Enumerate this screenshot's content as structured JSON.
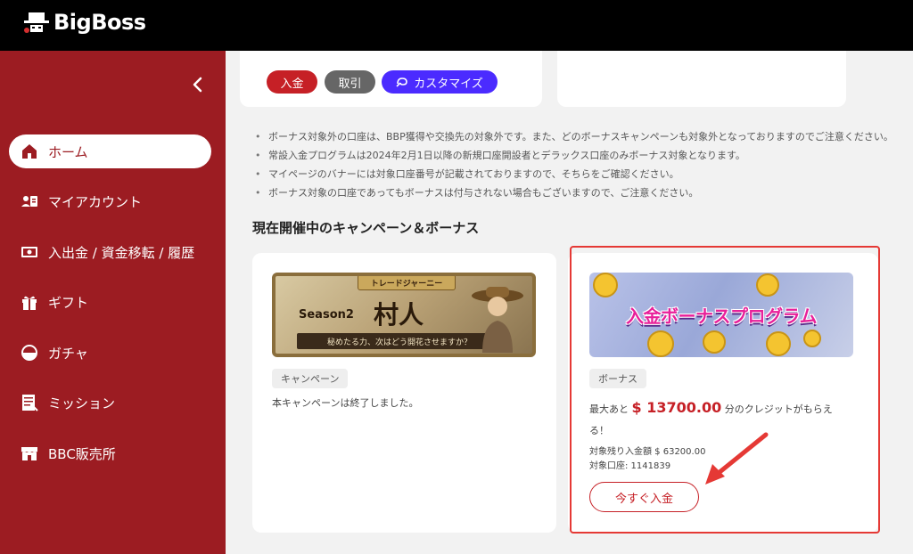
{
  "header": {
    "logo_text": "BigBoss"
  },
  "sidebar": {
    "items": [
      {
        "label": "ホーム",
        "icon": "home-icon",
        "active": true
      },
      {
        "label": "マイアカウント",
        "icon": "account-icon",
        "active": false
      },
      {
        "label": "入出金 / 資金移転 / 履歴",
        "icon": "money-icon",
        "active": false
      },
      {
        "label": "ギフト",
        "icon": "gift-icon",
        "active": false
      },
      {
        "label": "ガチャ",
        "icon": "gacha-icon",
        "active": false
      },
      {
        "label": "ミッション",
        "icon": "mission-icon",
        "active": false
      },
      {
        "label": "BBC販売所",
        "icon": "shop-icon",
        "active": false
      }
    ]
  },
  "account_card": {
    "deposit_label": "入金",
    "trade_label": "取引",
    "customize_label": "カスタマイズ"
  },
  "notes": [
    "ボーナス対象外の口座は、BBP獲得や交換先の対象外です。また、どのボーナスキャンペーンも対象外となっておりますのでご注意ください。",
    "常設入金プログラムは2024年2月1日以降の新規口座開設者とデラックス口座のみボーナス対象となります。",
    "マイページのバナーには対象口座番号が記載されておりますので、そちらをご確認ください。",
    "ボーナス対象の口座であってもボーナスは付与されない場合もございますので、ご注意ください。"
  ],
  "section_title": "現在開催中のキャンペーン＆ボーナス",
  "campaign": {
    "banner_plate": "トレードジャーニー",
    "banner_season": "Season2",
    "banner_title": "村人",
    "banner_subtitle": "秘めたる力、次はどう開花させますか？",
    "tag": "キャンペーン",
    "status": "本キャンペーンは終了しました。"
  },
  "bonus": {
    "banner_title": "入金ボーナスプログラム",
    "tag": "ボーナス",
    "prefix": "最大あと",
    "amount": "$ 13700.00",
    "suffix": "分のクレジットがもらえる！",
    "remaining": "対象残り入金額 $ 63200.00",
    "account": "対象口座: 1141839",
    "cta_label": "今すぐ入金"
  },
  "colors": {
    "brand_red": "#9c1c22",
    "button_red": "#c62026",
    "button_gray": "#666666",
    "button_purple": "#4b2bff",
    "highlight_red": "#e53935"
  }
}
